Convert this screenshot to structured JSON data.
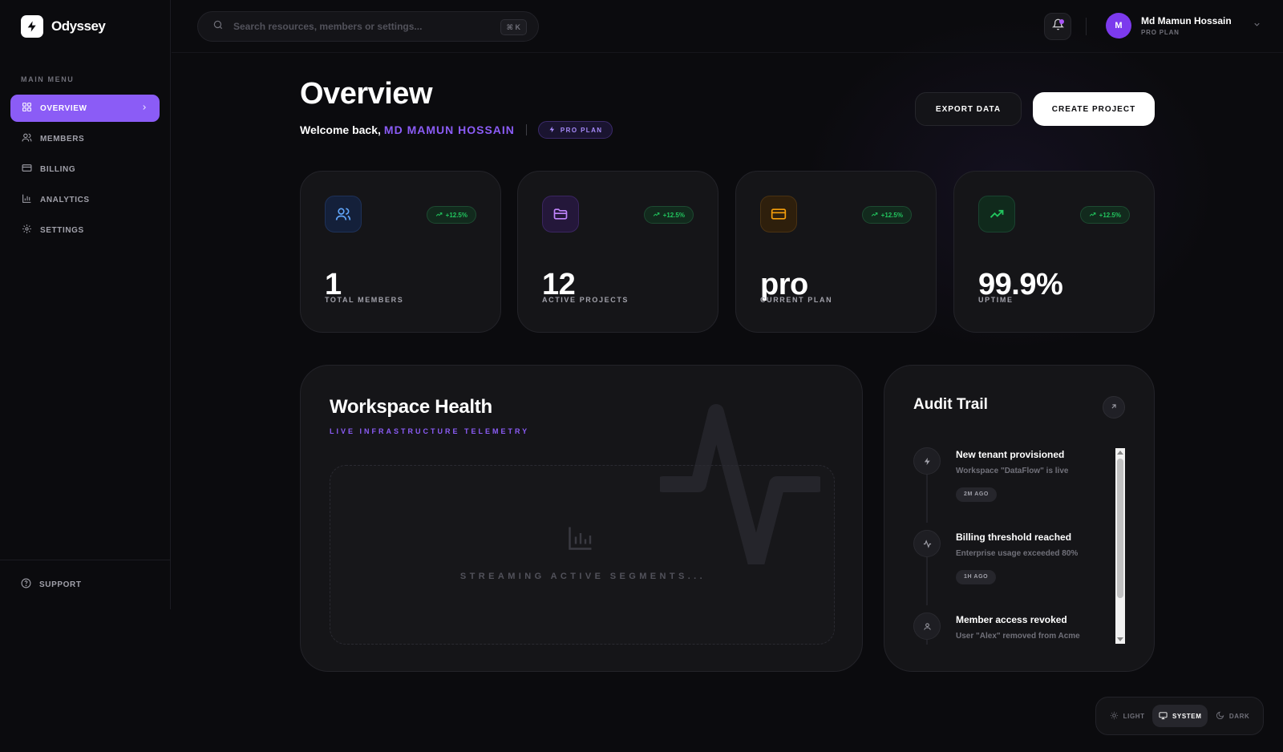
{
  "app": {
    "name": "Odyssey"
  },
  "sidebar": {
    "menu_label": "MAIN MENU",
    "items": [
      {
        "label": "OVERVIEW",
        "icon": "grid-icon",
        "active": true
      },
      {
        "label": "MEMBERS",
        "icon": "users-icon",
        "active": false
      },
      {
        "label": "BILLING",
        "icon": "credit-card-icon",
        "active": false
      },
      {
        "label": "ANALYTICS",
        "icon": "bar-chart-icon",
        "active": false
      },
      {
        "label": "SETTINGS",
        "icon": "gear-icon",
        "active": false
      }
    ],
    "support_label": "SUPPORT"
  },
  "topbar": {
    "search_placeholder": "Search resources, members or settings...",
    "shortcut": "⌘ K",
    "user": {
      "initial": "M",
      "name": "Md Mamun Hossain",
      "plan": "PRO PLAN"
    }
  },
  "header": {
    "title": "Overview",
    "welcome_prefix": "Welcome back,",
    "welcome_name": "MD MAMUN HOSSAIN",
    "plan_badge": "PRO PLAN",
    "export_label": "EXPORT DATA",
    "create_label": "CREATE PROJECT"
  },
  "stats": [
    {
      "value": "1",
      "label": "TOTAL MEMBERS",
      "trend": "+12.5%",
      "icon": "users-icon",
      "accent": "#3b82f6"
    },
    {
      "value": "12",
      "label": "ACTIVE PROJECTS",
      "trend": "+12.5%",
      "icon": "folder-icon",
      "accent": "#a855f7"
    },
    {
      "value": "pro",
      "label": "CURRENT PLAN",
      "trend": "+12.5%",
      "icon": "credit-card-icon",
      "accent": "#f59e0b"
    },
    {
      "value": "99.9%",
      "label": "UPTIME",
      "trend": "+12.5%",
      "icon": "trending-up-icon",
      "accent": "#22c55e"
    }
  ],
  "health": {
    "title": "Workspace Health",
    "subtitle": "LIVE INFRASTRUCTURE TELEMETRY",
    "status": "STREAMING ACTIVE SEGMENTS..."
  },
  "audit": {
    "title": "Audit Trail",
    "items": [
      {
        "title": "New tenant provisioned",
        "desc": "Workspace \"DataFlow\" is live",
        "time": "2M AGO",
        "icon": "bolt-icon"
      },
      {
        "title": "Billing threshold reached",
        "desc": "Enterprise usage exceeded 80%",
        "time": "1H AGO",
        "icon": "activity-icon"
      },
      {
        "title": "Member access revoked",
        "desc": "User \"Alex\" removed from Acme",
        "time": "",
        "icon": "user-icon"
      }
    ]
  },
  "theme": {
    "options": [
      "LIGHT",
      "SYSTEM",
      "DARK"
    ],
    "selected": "SYSTEM"
  },
  "colors": {
    "accent": "#8b5cf6",
    "background": "#0b0b0e",
    "card": "#151518",
    "success": "#22c55e"
  }
}
